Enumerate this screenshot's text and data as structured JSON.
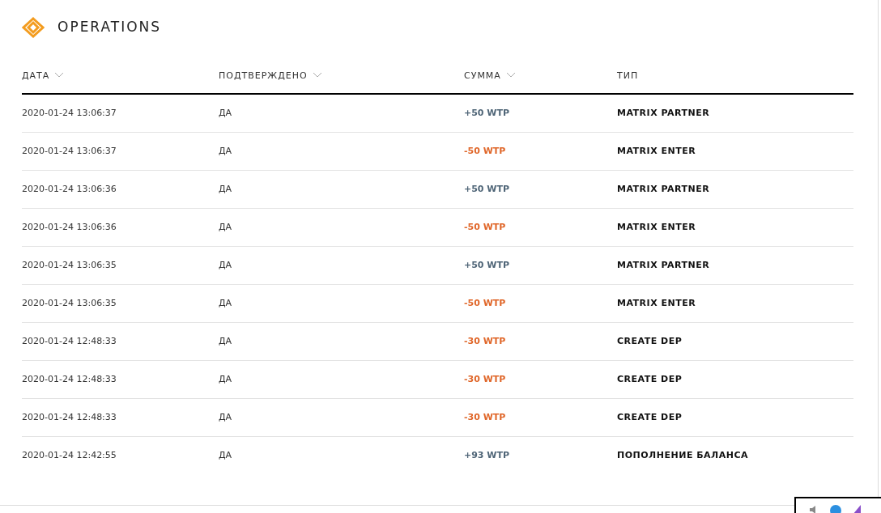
{
  "title": "OPERATIONS",
  "table": {
    "columns": [
      {
        "label": "ДАТА",
        "sortable": true
      },
      {
        "label": "ПОДТВЕРЖДЕНО",
        "sortable": true
      },
      {
        "label": "СУММА",
        "sortable": true
      },
      {
        "label": "ТИП",
        "sortable": false
      }
    ],
    "rows": [
      {
        "date": "2020-01-24 13:06:37",
        "confirmed": "ДА",
        "amount": "+50 WTP",
        "kind": "credit",
        "type": "MATRIX PARTNER"
      },
      {
        "date": "2020-01-24 13:06:37",
        "confirmed": "ДА",
        "amount": "-50 WTP",
        "kind": "debit",
        "type": "MATRIX ENTER"
      },
      {
        "date": "2020-01-24 13:06:36",
        "confirmed": "ДА",
        "amount": "+50 WTP",
        "kind": "credit",
        "type": "MATRIX PARTNER"
      },
      {
        "date": "2020-01-24 13:06:36",
        "confirmed": "ДА",
        "amount": "-50 WTP",
        "kind": "debit",
        "type": "MATRIX ENTER"
      },
      {
        "date": "2020-01-24 13:06:35",
        "confirmed": "ДА",
        "amount": "+50 WTP",
        "kind": "credit",
        "type": "MATRIX PARTNER"
      },
      {
        "date": "2020-01-24 13:06:35",
        "confirmed": "ДА",
        "amount": "-50 WTP",
        "kind": "debit",
        "type": "MATRIX ENTER"
      },
      {
        "date": "2020-01-24 12:48:33",
        "confirmed": "ДА",
        "amount": "-30 WTP",
        "kind": "debit",
        "type": "CREATE DEP"
      },
      {
        "date": "2020-01-24 12:48:33",
        "confirmed": "ДА",
        "amount": "-30 WTP",
        "kind": "debit",
        "type": "CREATE DEP"
      },
      {
        "date": "2020-01-24 12:48:33",
        "confirmed": "ДА",
        "amount": "-30 WTP",
        "kind": "debit",
        "type": "CREATE DEP"
      },
      {
        "date": "2020-01-24 12:42:55",
        "confirmed": "ДА",
        "amount": "+93 WTP",
        "kind": "credit",
        "type": "ПОПОЛНЕНИЕ БАЛАНСА"
      }
    ]
  }
}
